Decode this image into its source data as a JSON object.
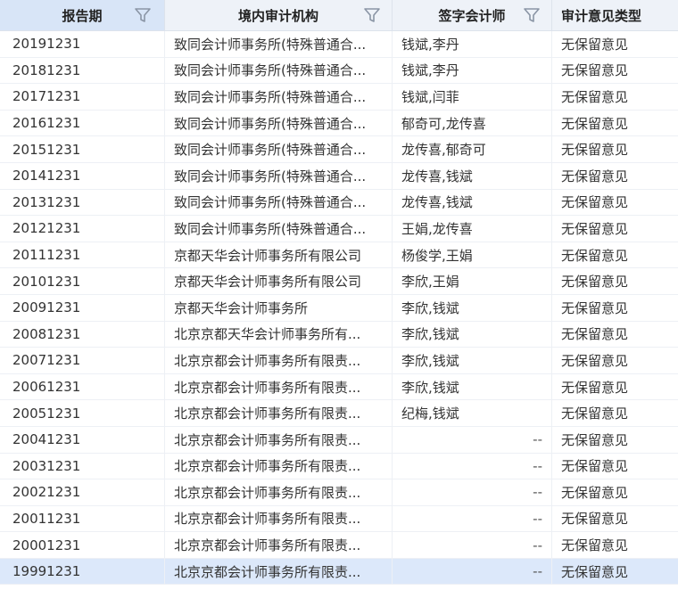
{
  "header": {
    "col1": "报告期",
    "col2": "境内审计机构",
    "col3": "签字会计师",
    "col4": "审计意见类型"
  },
  "icons": {
    "filter": "filter-icon"
  },
  "rows": [
    {
      "period": "20191231",
      "firm": "致同会计师事务所(特殊普通合...",
      "signers": "钱斌,李丹",
      "opinion": "无保留意见"
    },
    {
      "period": "20181231",
      "firm": "致同会计师事务所(特殊普通合...",
      "signers": "钱斌,李丹",
      "opinion": "无保留意见"
    },
    {
      "period": "20171231",
      "firm": "致同会计师事务所(特殊普通合...",
      "signers": "钱斌,闫菲",
      "opinion": "无保留意见"
    },
    {
      "period": "20161231",
      "firm": "致同会计师事务所(特殊普通合...",
      "signers": "郁奇可,龙传喜",
      "opinion": "无保留意见"
    },
    {
      "period": "20151231",
      "firm": "致同会计师事务所(特殊普通合...",
      "signers": "龙传喜,郁奇可",
      "opinion": "无保留意见"
    },
    {
      "period": "20141231",
      "firm": "致同会计师事务所(特殊普通合...",
      "signers": "龙传喜,钱斌",
      "opinion": "无保留意见"
    },
    {
      "period": "20131231",
      "firm": "致同会计师事务所(特殊普通合...",
      "signers": "龙传喜,钱斌",
      "opinion": "无保留意见"
    },
    {
      "period": "20121231",
      "firm": "致同会计师事务所(特殊普通合...",
      "signers": "王娟,龙传喜",
      "opinion": "无保留意见"
    },
    {
      "period": "20111231",
      "firm": "京都天华会计师事务所有限公司",
      "signers": "杨俊学,王娟",
      "opinion": "无保留意见"
    },
    {
      "period": "20101231",
      "firm": "京都天华会计师事务所有限公司",
      "signers": "李欣,王娟",
      "opinion": "无保留意见"
    },
    {
      "period": "20091231",
      "firm": "京都天华会计师事务所",
      "signers": "李欣,钱斌",
      "opinion": "无保留意见"
    },
    {
      "period": "20081231",
      "firm": "北京京都天华会计师事务所有...",
      "signers": "李欣,钱斌",
      "opinion": "无保留意见"
    },
    {
      "period": "20071231",
      "firm": "北京京都会计师事务所有限责...",
      "signers": "李欣,钱斌",
      "opinion": "无保留意见"
    },
    {
      "period": "20061231",
      "firm": "北京京都会计师事务所有限责...",
      "signers": "李欣,钱斌",
      "opinion": "无保留意见"
    },
    {
      "period": "20051231",
      "firm": "北京京都会计师事务所有限责...",
      "signers": "纪梅,钱斌",
      "opinion": "无保留意见"
    },
    {
      "period": "20041231",
      "firm": "北京京都会计师事务所有限责...",
      "signers": "--",
      "opinion": "无保留意见"
    },
    {
      "period": "20031231",
      "firm": "北京京都会计师事务所有限责...",
      "signers": "--",
      "opinion": "无保留意见"
    },
    {
      "period": "20021231",
      "firm": "北京京都会计师事务所有限责...",
      "signers": "--",
      "opinion": "无保留意见"
    },
    {
      "period": "20011231",
      "firm": "北京京都会计师事务所有限责...",
      "signers": "--",
      "opinion": "无保留意见"
    },
    {
      "period": "20001231",
      "firm": "北京京都会计师事务所有限责...",
      "signers": "--",
      "opinion": "无保留意见"
    },
    {
      "period": "19991231",
      "firm": "北京京都会计师事务所有限责...",
      "signers": "--",
      "opinion": "无保留意见",
      "selected": true
    }
  ]
}
